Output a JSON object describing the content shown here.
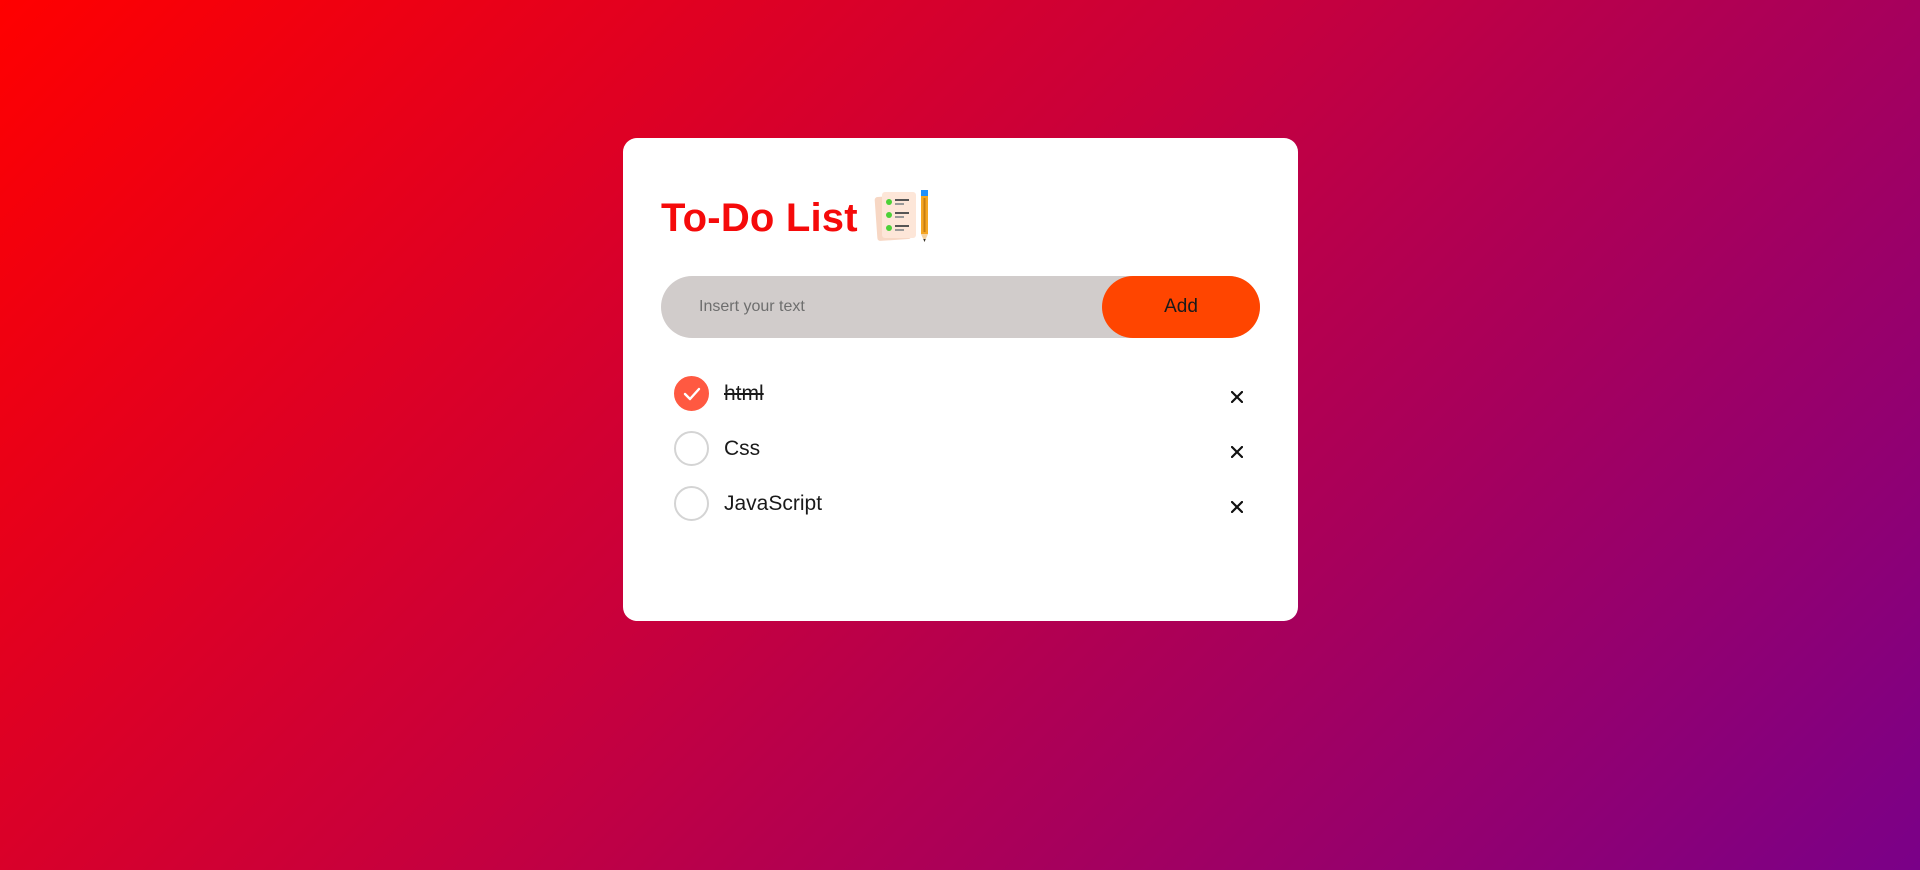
{
  "app": {
    "title": "To-Do List",
    "title_icon": "checklist-pencil-icon",
    "title_color": "#f50a0a",
    "background_gradient": [
      "#ff0000",
      "#c8003c",
      "#7a0088"
    ]
  },
  "input": {
    "placeholder": "Insert your text",
    "value": "",
    "add_label": "Add",
    "add_color": "#ff4500"
  },
  "todos": [
    {
      "text": "html",
      "done": true
    },
    {
      "text": "Css",
      "done": false
    },
    {
      "text": "JavaScript",
      "done": false
    }
  ],
  "icons": {
    "check": "check-icon",
    "delete": "close-icon"
  },
  "colors": {
    "checked_fill": "#ff5941",
    "unchecked_border": "#d4d4d4"
  }
}
